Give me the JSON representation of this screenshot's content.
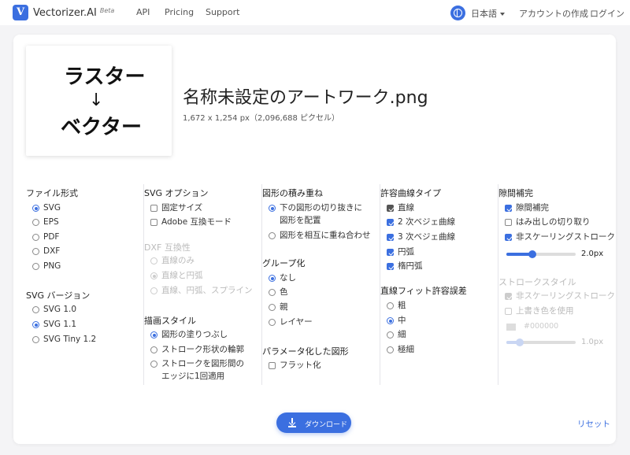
{
  "nav": {
    "brand": "Vectorizer.AI",
    "beta": "Beta",
    "links": [
      "API",
      "Pricing",
      "Support"
    ],
    "language": "日本語",
    "create_account": "アカウントの作成",
    "login": "ログイン"
  },
  "file": {
    "thumbnail_text_top": "ラスター",
    "thumbnail_arrow": "↓",
    "thumbnail_text_bottom": "ベクター",
    "title": "名称未設定のアートワーク.png",
    "meta": "1,672 x 1,254 px（2,096,688 ピクセル）"
  },
  "file_format": {
    "title": "ファイル形式",
    "options": [
      "SVG",
      "EPS",
      "PDF",
      "DXF",
      "PNG"
    ],
    "selected": "SVG"
  },
  "svg_version": {
    "title": "SVG バージョン",
    "options": [
      "SVG 1.0",
      "SVG 1.1",
      "SVG Tiny 1.2"
    ],
    "selected": "SVG 1.1"
  },
  "svg_options": {
    "title": "SVG オプション",
    "items": [
      {
        "label": "固定サイズ",
        "checked": false
      },
      {
        "label": "Adobe 互換モード",
        "checked": false
      }
    ]
  },
  "dxf_compat": {
    "title": "DXF 互換性",
    "options": [
      "直線のみ",
      "直線と円弧",
      "直線、円弧、スプライン"
    ],
    "selected": "直線と円弧"
  },
  "drawing_style": {
    "title": "描画スタイル",
    "options": [
      "図形の塗りつぶし",
      "ストローク形状の輪郭",
      "ストロークを図形間のエッジに1回適用"
    ],
    "selected": "図形の塗りつぶし"
  },
  "shape_stacking": {
    "title": "図形の積み重ね",
    "options": [
      "下の図形の切り抜きに図形を配置",
      "図形を相互に重ね合わせ"
    ],
    "selected": "下の図形の切り抜きに図形を配置"
  },
  "grouping": {
    "title": "グループ化",
    "options": [
      "なし",
      "色",
      "親",
      "レイヤー"
    ],
    "selected": "なし"
  },
  "parameterized": {
    "title": "パラメータ化した図形",
    "items": [
      {
        "label": "フラット化",
        "checked": false
      }
    ]
  },
  "curve_types": {
    "title": "許容曲線タイプ",
    "items": [
      {
        "label": "直線",
        "checked": true
      },
      {
        "label": "2 次ベジェ曲線",
        "checked": true
      },
      {
        "label": "3 次ベジェ曲線",
        "checked": true
      },
      {
        "label": "円弧",
        "checked": true
      },
      {
        "label": "楕円弧",
        "checked": true
      }
    ]
  },
  "line_fit": {
    "title": "直線フィット許容誤差",
    "options": [
      "粗",
      "中",
      "細",
      "極細"
    ],
    "selected": "中"
  },
  "gap_filler": {
    "title": "隙間補完",
    "items": [
      {
        "label": "隙間補完",
        "checked": true
      },
      {
        "label": "はみ出しの切り取り",
        "checked": false
      },
      {
        "label": "非スケーリングストローク",
        "checked": true
      }
    ],
    "stroke_width": "2.0px",
    "stroke_fraction": 0.38
  },
  "stroke_style": {
    "title": "ストロークスタイル",
    "items": [
      {
        "label": "非スケーリングストローク",
        "checked": true
      },
      {
        "label": "上書き色を使用",
        "checked": false
      }
    ],
    "color": "#000000",
    "stroke_width": "1.0px",
    "stroke_fraction": 0.19
  },
  "actions": {
    "download": "ダウンロード",
    "reset": "リセット"
  },
  "colors": {
    "accent": "#3b6fe0"
  }
}
